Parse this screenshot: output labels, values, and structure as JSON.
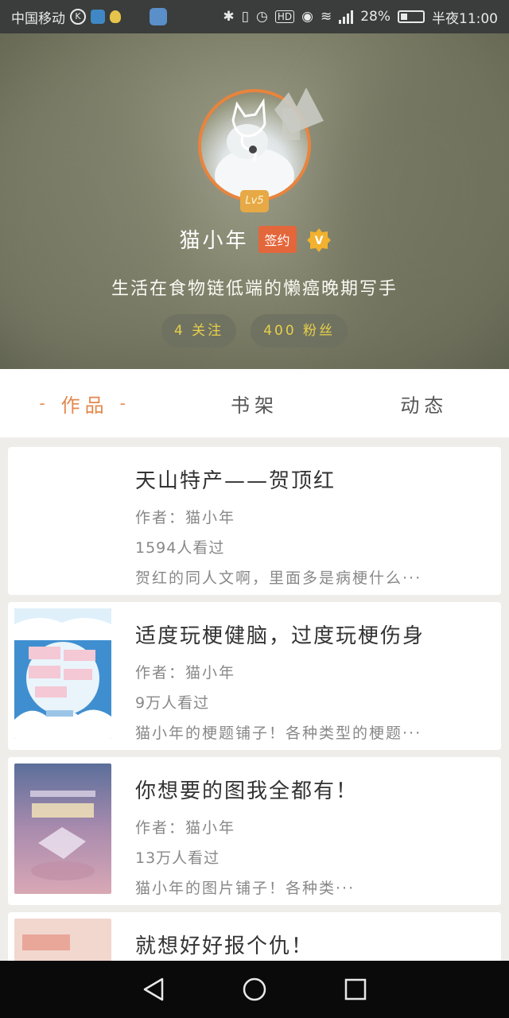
{
  "status_bar": {
    "carrier": "中国移动",
    "battery": "28%",
    "time": "半夜11:00"
  },
  "profile": {
    "level": "Lv5",
    "name": "猫小年",
    "sign_badge": "签约",
    "verified_badge": "V",
    "bio": "生活在食物链低端的懒癌晚期写手",
    "following": "4 关注",
    "followers": "400 粉丝"
  },
  "tabs": [
    {
      "label": "作品",
      "active": true
    },
    {
      "label": "书架",
      "active": false
    },
    {
      "label": "动态",
      "active": false
    }
  ],
  "works": [
    {
      "title": "天山特产——贺顶红",
      "author": "作者：猫小年",
      "views": "1594人看过",
      "desc": "贺红的同人文啊，里面多是病梗什么···",
      "cover": "none"
    },
    {
      "title": "适度玩梗健脑，过度玩梗伤身",
      "author": "作者：猫小年",
      "views": "9万人看过",
      "desc": "猫小年的梗题铺子！各种类型的梗题···",
      "cover": "blue-cloud"
    },
    {
      "title": "你想要的图我全都有！",
      "author": "作者：猫小年",
      "views": "13万人看过",
      "desc": "猫小年的图片铺子！各种类···",
      "cover": "purple-sky"
    },
    {
      "title": "就想好好报个仇！",
      "author": "",
      "views": "",
      "desc": "",
      "cover": "pink"
    }
  ],
  "colors": {
    "accent": "#e4884c",
    "sign_badge": "#e4663b",
    "level_badge": "#e7a945",
    "pill_text": "#e6d04a"
  }
}
